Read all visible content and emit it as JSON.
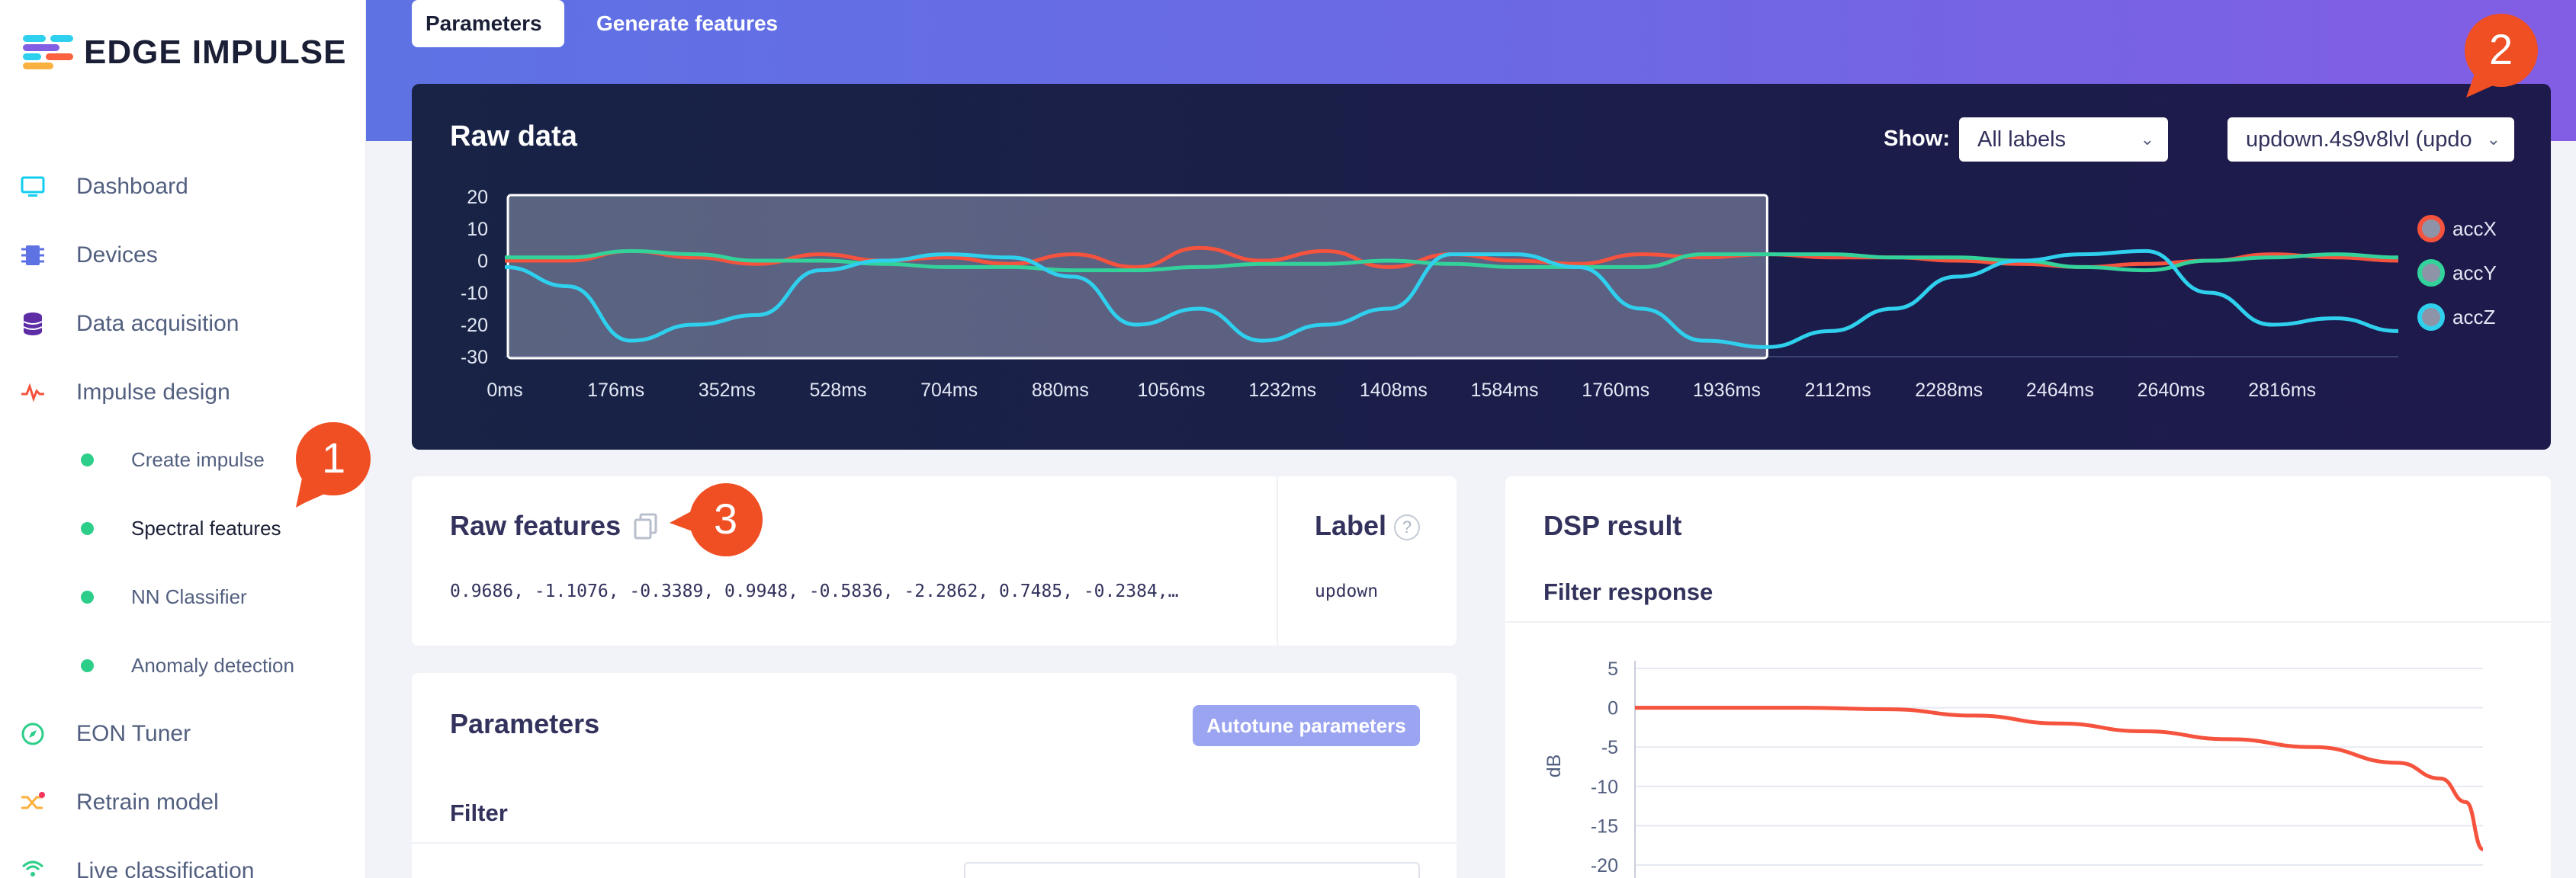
{
  "app": {
    "brand": "EDGE IMPULSE"
  },
  "sidebar": {
    "items": [
      {
        "label": "Dashboard",
        "icon": "monitor-icon"
      },
      {
        "label": "Devices",
        "icon": "chip-icon"
      },
      {
        "label": "Data acquisition",
        "icon": "database-icon"
      },
      {
        "label": "Impulse design",
        "icon": "pulse-icon"
      },
      {
        "label": "EON Tuner",
        "icon": "compass-icon"
      },
      {
        "label": "Retrain model",
        "icon": "shuffle-icon"
      },
      {
        "label": "Live classification",
        "icon": "signal-icon"
      }
    ],
    "sub_items": [
      {
        "label": "Create impulse"
      },
      {
        "label": "Spectral features",
        "active": true
      },
      {
        "label": "NN Classifier"
      },
      {
        "label": "Anomaly detection"
      }
    ]
  },
  "tabs": [
    {
      "label": "Parameters",
      "active": true
    },
    {
      "label": "Generate features",
      "active": false
    }
  ],
  "raw_data": {
    "title": "Raw data",
    "show_label": "Show:",
    "show_value": "All labels",
    "sample_value": "updown.4s9v8lvl (updo",
    "legend": [
      {
        "name": "accX",
        "color": "#f5533d"
      },
      {
        "name": "accY",
        "color": "#33d29b"
      },
      {
        "name": "accZ",
        "color": "#2fd0ee"
      }
    ]
  },
  "raw_features": {
    "title": "Raw features",
    "values": "0.9686, -1.1076, -0.3389, 0.9948, -0.5836, -2.2862, 0.7485, -0.2384,…"
  },
  "label_card": {
    "title": "Label",
    "value": "updown"
  },
  "parameters": {
    "title": "Parameters",
    "autotune_label": "Autotune parameters",
    "filter_label": "Filter"
  },
  "dsp_result": {
    "title": "DSP result",
    "filter_response_label": "Filter response"
  },
  "callouts": [
    "1",
    "2",
    "3"
  ],
  "chart_data": [
    {
      "type": "line",
      "title": "",
      "x_ticks": [
        "0ms",
        "176ms",
        "352ms",
        "528ms",
        "704ms",
        "880ms",
        "1056ms",
        "1232ms",
        "1408ms",
        "1584ms",
        "1760ms",
        "1936ms",
        "2112ms",
        "2288ms",
        "2464ms",
        "2640ms",
        "2816ms"
      ],
      "y_ticks": [
        "20",
        "10",
        "0",
        "-10",
        "-20",
        "-30"
      ],
      "ylim": [
        -30,
        20
      ],
      "xlim_ms": [
        0,
        3000
      ],
      "window_ms": [
        0,
        2000
      ],
      "series": [
        {
          "name": "accX",
          "color": "#f5533d",
          "x_ms": [
            0,
            100,
            200,
            300,
            400,
            500,
            600,
            700,
            800,
            900,
            1000,
            1100,
            1200,
            1300,
            1400,
            1500,
            1600,
            1700,
            1800,
            1900,
            2000,
            2100,
            2200,
            2300,
            2400,
            2500,
            2600,
            2700,
            2800,
            2900,
            3000
          ],
          "values": [
            0,
            0,
            3,
            1,
            -1,
            2,
            0,
            1,
            -1,
            2,
            -2,
            4,
            0,
            3,
            -2,
            2,
            0,
            -1,
            2,
            1,
            2,
            1,
            1,
            0,
            -1,
            -2,
            -1,
            0,
            2,
            1,
            0
          ]
        },
        {
          "name": "accY",
          "color": "#33d29b",
          "x_ms": [
            0,
            100,
            200,
            300,
            400,
            500,
            600,
            700,
            800,
            900,
            1000,
            1100,
            1200,
            1300,
            1400,
            1500,
            1600,
            1700,
            1800,
            1900,
            2000,
            2100,
            2200,
            2300,
            2400,
            2500,
            2600,
            2700,
            2800,
            2900,
            3000
          ],
          "values": [
            1,
            1,
            3,
            2,
            0,
            0,
            -1,
            -2,
            -2,
            -3,
            -3,
            -2,
            -1,
            -1,
            0,
            -1,
            -2,
            -2,
            -2,
            2,
            2,
            2,
            1,
            1,
            0,
            -2,
            -3,
            0,
            1,
            2,
            1
          ]
        },
        {
          "name": "accZ",
          "color": "#2fd0ee",
          "x_ms": [
            0,
            100,
            200,
            300,
            400,
            500,
            600,
            700,
            800,
            900,
            1000,
            1100,
            1200,
            1300,
            1400,
            1500,
            1600,
            1700,
            1800,
            1900,
            2000,
            2100,
            2200,
            2300,
            2400,
            2500,
            2600,
            2700,
            2800,
            2900,
            3000
          ],
          "values": [
            -2,
            -8,
            -25,
            -20,
            -17,
            -3,
            0,
            2,
            1,
            -5,
            -20,
            -15,
            -25,
            -20,
            -15,
            2,
            2,
            -2,
            -15,
            -25,
            -27,
            -22,
            -15,
            -5,
            0,
            2,
            3,
            -10,
            -20,
            -18,
            -22
          ]
        }
      ]
    },
    {
      "type": "line",
      "title": "Filter response",
      "ylabel": "dB",
      "y_ticks": [
        "5",
        "0",
        "-5",
        "-10",
        "-15",
        "-20"
      ],
      "ylim": [
        -20,
        5
      ],
      "series": [
        {
          "name": "",
          "color": "#f5533d",
          "x": [
            0,
            0.1,
            0.2,
            0.3,
            0.4,
            0.5,
            0.6,
            0.7,
            0.8,
            0.9,
            0.95,
            0.98,
            1.0
          ],
          "values": [
            0,
            0,
            0,
            -0.2,
            -1,
            -2,
            -3,
            -4,
            -5,
            -7,
            -9,
            -12,
            -18
          ]
        }
      ]
    }
  ]
}
